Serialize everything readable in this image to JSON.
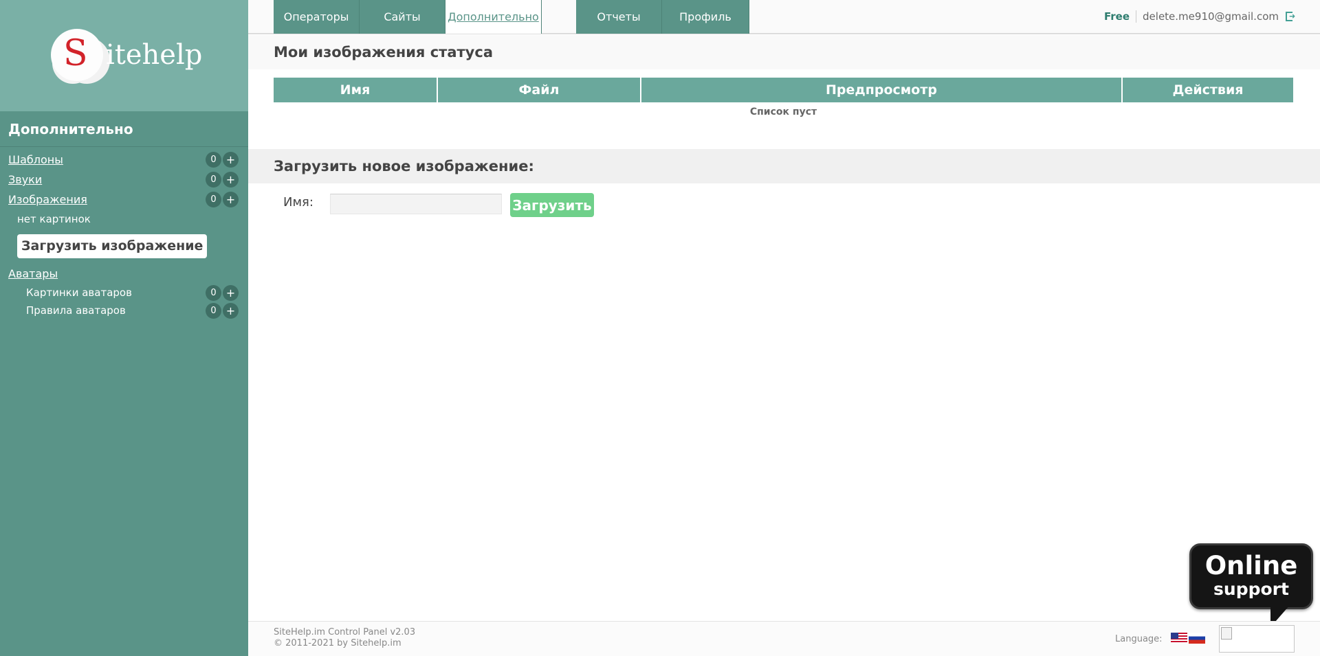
{
  "logo": {
    "letter": "S",
    "text": "itehelp"
  },
  "sidebar": {
    "title": "Дополнительно",
    "items": [
      {
        "label": "Шаблоны",
        "count": "0",
        "plus": "+"
      },
      {
        "label": "Звуки",
        "count": "0",
        "plus": "+"
      },
      {
        "label": "Изображения",
        "count": "0",
        "plus": "+"
      }
    ],
    "no_images_note": "нет картинок",
    "upload_image_button": "Загрузить изображение",
    "avatars": {
      "label": "Аватары",
      "sub_items": [
        {
          "label": "Картинки аватаров",
          "count": "0",
          "plus": "+"
        },
        {
          "label": "Правила аватаров",
          "count": "0",
          "plus": "+"
        }
      ]
    }
  },
  "nav": {
    "tabs": [
      {
        "label": "Операторы"
      },
      {
        "label": "Сайты"
      },
      {
        "label": "Дополнительно",
        "active": true
      },
      {
        "label": "Отчеты"
      },
      {
        "label": "Профиль"
      }
    ],
    "plan": "Free",
    "email": "delete.me910@gmail.com",
    "logout_icon": "logout-icon"
  },
  "status_images": {
    "title": "Мои изображения статуса",
    "columns": [
      "Имя",
      "Файл",
      "Предпросмотр",
      "Действия"
    ],
    "empty_text": "Список пуст"
  },
  "upload": {
    "title": "Загрузить новое изображение:",
    "name_label": "Имя:",
    "name_value": "",
    "button_label": "Загрузить"
  },
  "footer": {
    "version": "SiteHelp.im Control Panel v2.03",
    "copyright": "© 2011-2021 by Sitehelp.im",
    "language_label": "Language:",
    "flags": [
      "us-flag-icon",
      "ru-flag-icon"
    ]
  },
  "online_support": {
    "line1": "Online",
    "line2": "support"
  },
  "colors": {
    "sidebar": "#5a9488",
    "logo_bg": "#7ab0a6",
    "table_header": "#6aa89c",
    "upload_button": "#6fd08a",
    "plan_text": "#2e7d6f"
  }
}
